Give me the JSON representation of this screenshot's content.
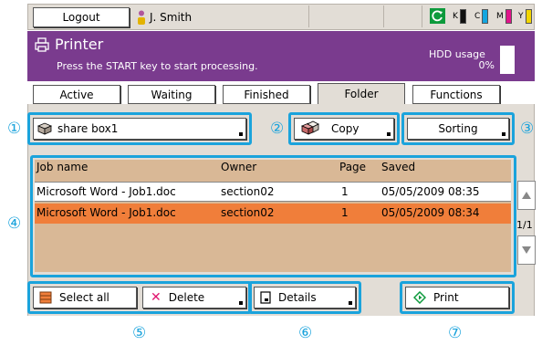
{
  "topbar": {
    "logout_label": "Logout",
    "user_name": "J. Smith",
    "toners": [
      {
        "letter": "K",
        "color": "#111111"
      },
      {
        "letter": "C",
        "color": "#14a6e0"
      },
      {
        "letter": "M",
        "color": "#e0148a"
      },
      {
        "letter": "Y",
        "color": "#f2d600"
      }
    ]
  },
  "header": {
    "title": "Printer",
    "message": "Press the START key to start processing.",
    "hdd_label": "HDD usage",
    "hdd_value": "0%"
  },
  "tabs": [
    {
      "label": "Active"
    },
    {
      "label": "Waiting"
    },
    {
      "label": "Finished"
    },
    {
      "label": "Folder",
      "active": true
    },
    {
      "label": "Functions"
    }
  ],
  "folder": {
    "box_label": "share box1",
    "copy_label": "Copy",
    "sorting_label": "Sorting"
  },
  "table": {
    "headers": {
      "job": "Job name",
      "owner": "Owner",
      "page": "Page",
      "saved": "Saved"
    },
    "rows": [
      {
        "job": "Microsoft Word - Job1.doc",
        "owner": "section02",
        "page": "1",
        "saved": "05/05/2009 08:35",
        "selected": false
      },
      {
        "job": "Microsoft Word - Job1.doc",
        "owner": "section02",
        "page": "1",
        "saved": "05/05/2009 08:34",
        "selected": true
      }
    ],
    "page_indicator": "1/1"
  },
  "bottom": {
    "select_all_label": "Select all",
    "delete_label": "Delete",
    "details_label": "Details",
    "print_label": "Print"
  },
  "callouts": [
    "①",
    "②",
    "③",
    "④",
    "⑤",
    "⑥",
    "⑦"
  ],
  "colors": {
    "header_purple": "#7a3b8e",
    "highlight_blue": "#1aa3dc",
    "selected_row": "#f07e3a",
    "list_bg": "#d9b896"
  }
}
